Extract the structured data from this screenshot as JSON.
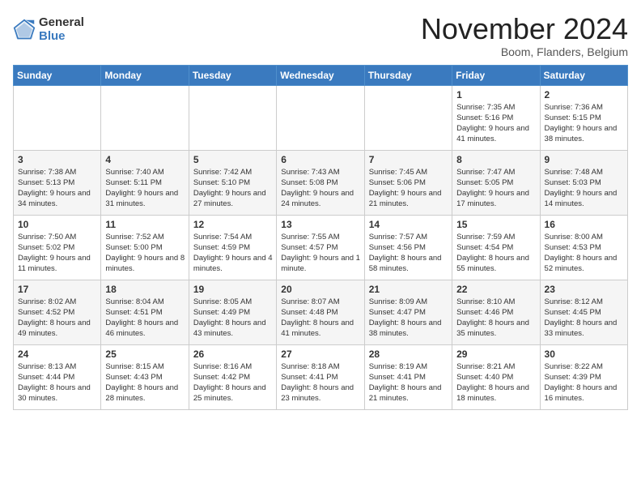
{
  "logo": {
    "general": "General",
    "blue": "Blue"
  },
  "title": "November 2024",
  "subtitle": "Boom, Flanders, Belgium",
  "headers": [
    "Sunday",
    "Monday",
    "Tuesday",
    "Wednesday",
    "Thursday",
    "Friday",
    "Saturday"
  ],
  "weeks": [
    [
      {
        "day": "",
        "info": ""
      },
      {
        "day": "",
        "info": ""
      },
      {
        "day": "",
        "info": ""
      },
      {
        "day": "",
        "info": ""
      },
      {
        "day": "",
        "info": ""
      },
      {
        "day": "1",
        "info": "Sunrise: 7:35 AM\nSunset: 5:16 PM\nDaylight: 9 hours\nand 41 minutes."
      },
      {
        "day": "2",
        "info": "Sunrise: 7:36 AM\nSunset: 5:15 PM\nDaylight: 9 hours\nand 38 minutes."
      }
    ],
    [
      {
        "day": "3",
        "info": "Sunrise: 7:38 AM\nSunset: 5:13 PM\nDaylight: 9 hours\nand 34 minutes."
      },
      {
        "day": "4",
        "info": "Sunrise: 7:40 AM\nSunset: 5:11 PM\nDaylight: 9 hours\nand 31 minutes."
      },
      {
        "day": "5",
        "info": "Sunrise: 7:42 AM\nSunset: 5:10 PM\nDaylight: 9 hours\nand 27 minutes."
      },
      {
        "day": "6",
        "info": "Sunrise: 7:43 AM\nSunset: 5:08 PM\nDaylight: 9 hours\nand 24 minutes."
      },
      {
        "day": "7",
        "info": "Sunrise: 7:45 AM\nSunset: 5:06 PM\nDaylight: 9 hours\nand 21 minutes."
      },
      {
        "day": "8",
        "info": "Sunrise: 7:47 AM\nSunset: 5:05 PM\nDaylight: 9 hours\nand 17 minutes."
      },
      {
        "day": "9",
        "info": "Sunrise: 7:48 AM\nSunset: 5:03 PM\nDaylight: 9 hours\nand 14 minutes."
      }
    ],
    [
      {
        "day": "10",
        "info": "Sunrise: 7:50 AM\nSunset: 5:02 PM\nDaylight: 9 hours\nand 11 minutes."
      },
      {
        "day": "11",
        "info": "Sunrise: 7:52 AM\nSunset: 5:00 PM\nDaylight: 9 hours\nand 8 minutes."
      },
      {
        "day": "12",
        "info": "Sunrise: 7:54 AM\nSunset: 4:59 PM\nDaylight: 9 hours\nand 4 minutes."
      },
      {
        "day": "13",
        "info": "Sunrise: 7:55 AM\nSunset: 4:57 PM\nDaylight: 9 hours\nand 1 minute."
      },
      {
        "day": "14",
        "info": "Sunrise: 7:57 AM\nSunset: 4:56 PM\nDaylight: 8 hours\nand 58 minutes."
      },
      {
        "day": "15",
        "info": "Sunrise: 7:59 AM\nSunset: 4:54 PM\nDaylight: 8 hours\nand 55 minutes."
      },
      {
        "day": "16",
        "info": "Sunrise: 8:00 AM\nSunset: 4:53 PM\nDaylight: 8 hours\nand 52 minutes."
      }
    ],
    [
      {
        "day": "17",
        "info": "Sunrise: 8:02 AM\nSunset: 4:52 PM\nDaylight: 8 hours\nand 49 minutes."
      },
      {
        "day": "18",
        "info": "Sunrise: 8:04 AM\nSunset: 4:51 PM\nDaylight: 8 hours\nand 46 minutes."
      },
      {
        "day": "19",
        "info": "Sunrise: 8:05 AM\nSunset: 4:49 PM\nDaylight: 8 hours\nand 43 minutes."
      },
      {
        "day": "20",
        "info": "Sunrise: 8:07 AM\nSunset: 4:48 PM\nDaylight: 8 hours\nand 41 minutes."
      },
      {
        "day": "21",
        "info": "Sunrise: 8:09 AM\nSunset: 4:47 PM\nDaylight: 8 hours\nand 38 minutes."
      },
      {
        "day": "22",
        "info": "Sunrise: 8:10 AM\nSunset: 4:46 PM\nDaylight: 8 hours\nand 35 minutes."
      },
      {
        "day": "23",
        "info": "Sunrise: 8:12 AM\nSunset: 4:45 PM\nDaylight: 8 hours\nand 33 minutes."
      }
    ],
    [
      {
        "day": "24",
        "info": "Sunrise: 8:13 AM\nSunset: 4:44 PM\nDaylight: 8 hours\nand 30 minutes."
      },
      {
        "day": "25",
        "info": "Sunrise: 8:15 AM\nSunset: 4:43 PM\nDaylight: 8 hours\nand 28 minutes."
      },
      {
        "day": "26",
        "info": "Sunrise: 8:16 AM\nSunset: 4:42 PM\nDaylight: 8 hours\nand 25 minutes."
      },
      {
        "day": "27",
        "info": "Sunrise: 8:18 AM\nSunset: 4:41 PM\nDaylight: 8 hours\nand 23 minutes."
      },
      {
        "day": "28",
        "info": "Sunrise: 8:19 AM\nSunset: 4:41 PM\nDaylight: 8 hours\nand 21 minutes."
      },
      {
        "day": "29",
        "info": "Sunrise: 8:21 AM\nSunset: 4:40 PM\nDaylight: 8 hours\nand 18 minutes."
      },
      {
        "day": "30",
        "info": "Sunrise: 8:22 AM\nSunset: 4:39 PM\nDaylight: 8 hours\nand 16 minutes."
      }
    ]
  ]
}
